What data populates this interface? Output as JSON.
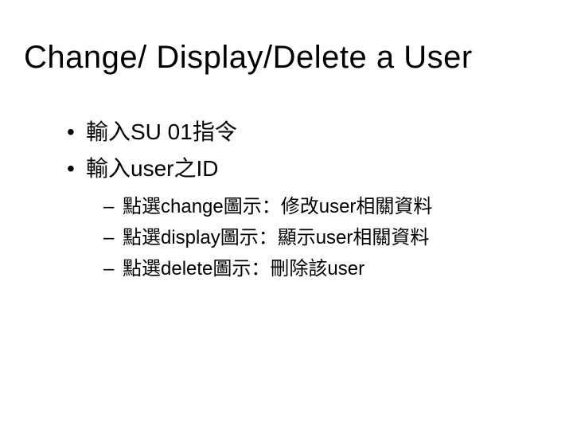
{
  "title": "Change/ Display/Delete a User",
  "bullets": {
    "b1": "輸入SU 01指令",
    "b2": "輸入user之ID"
  },
  "subbullets": {
    "s1": "點選change圖示：修改user相關資料",
    "s2": "點選display圖示：顯示user相關資料",
    "s3": "點選delete圖示：刪除該user"
  }
}
